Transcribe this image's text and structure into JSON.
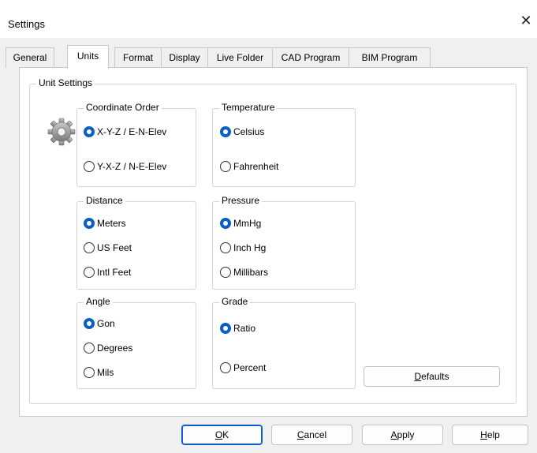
{
  "window": {
    "title": "Settings",
    "close_glyph": "✕"
  },
  "tabs": [
    {
      "label": "General"
    },
    {
      "label": "Units",
      "active": true
    },
    {
      "label": "Format"
    },
    {
      "label": "Display"
    },
    {
      "label": "Live Folder"
    },
    {
      "label": "CAD Program"
    },
    {
      "label": "BIM Program"
    }
  ],
  "unit_settings": {
    "label": "Unit Settings",
    "icon": "gear-icon",
    "coordinate_order": {
      "label": "Coordinate Order",
      "options": [
        "X-Y-Z / E-N-Elev",
        "Y-X-Z / N-E-Elev"
      ],
      "selected": "X-Y-Z / E-N-Elev"
    },
    "temperature": {
      "label": "Temperature",
      "options": [
        "Celsius",
        "Fahrenheit"
      ],
      "selected": "Celsius"
    },
    "distance": {
      "label": "Distance",
      "options": [
        "Meters",
        "US Feet",
        "Intl Feet"
      ],
      "selected": "Meters"
    },
    "pressure": {
      "label": "Pressure",
      "options": [
        "MmHg",
        "Inch Hg",
        "Millibars"
      ],
      "selected": "MmHg"
    },
    "angle": {
      "label": "Angle",
      "options": [
        "Gon",
        "Degrees",
        "Mils"
      ],
      "selected": "Gon"
    },
    "grade": {
      "label": "Grade",
      "options": [
        "Ratio",
        "Percent"
      ],
      "selected": "Ratio"
    },
    "defaults_button": {
      "mnemonic": "D",
      "rest": "efaults"
    }
  },
  "buttons": {
    "ok": {
      "mnemonic": "O",
      "rest": "K"
    },
    "cancel": {
      "mnemonic": "C",
      "rest": "ancel"
    },
    "apply": {
      "mnemonic": "A",
      "rest": "pply"
    },
    "help": {
      "mnemonic": "H",
      "rest": "elp"
    }
  },
  "colors": {
    "accent": "#0a5fc4",
    "panel": "#ffffff",
    "background": "#f0f0f0"
  }
}
